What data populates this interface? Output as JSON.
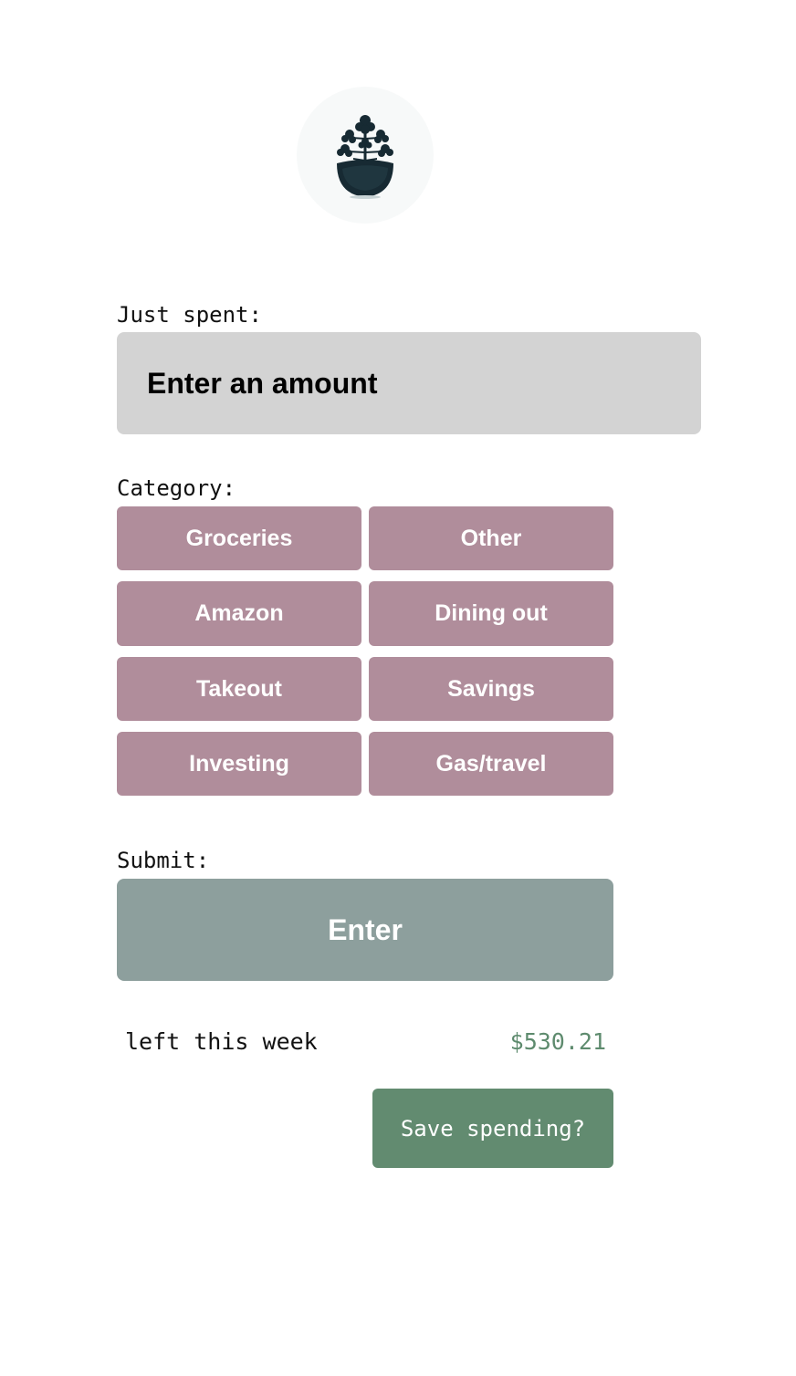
{
  "logo": {
    "icon": "plant-bowl-icon"
  },
  "form": {
    "amount_label": "Just spent:",
    "amount_placeholder": "Enter an amount",
    "category_label": "Category:",
    "categories": [
      "Groceries",
      "Other",
      "Amazon",
      "Dining out",
      "Takeout",
      "Savings",
      "Investing",
      "Gas/travel"
    ],
    "submit_label": "Submit:",
    "enter_button": "Enter"
  },
  "summary": {
    "left_label": "left this week",
    "left_amount": "$530.21",
    "save_button": "Save spending?"
  },
  "colors": {
    "category_button": "#b08d9b",
    "enter_button": "#8d9f9d",
    "save_button": "#628b70",
    "amount_text": "#5e8b6e",
    "input_bg": "#d3d3d3"
  }
}
